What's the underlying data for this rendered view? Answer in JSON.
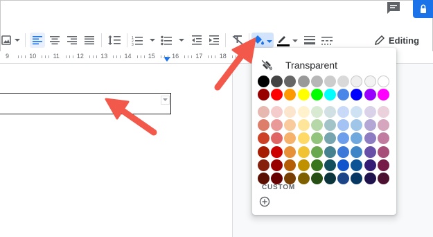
{
  "header": {
    "comment_icon": "comment-icon",
    "lock_icon": "lock-icon",
    "accent": "#1a73e8"
  },
  "toolbar": {
    "editing_label": "Editing",
    "icons": [
      "image-icon",
      "chevron-down-icon",
      "align-left-icon",
      "align-center-icon",
      "align-right-icon",
      "align-justify-icon",
      "line-spacing-icon",
      "numbered-list-icon",
      "bulleted-list-icon",
      "decrease-indent-icon",
      "increase-indent-icon",
      "clear-formatting-icon",
      "highlight-color-icon",
      "text-color-icon",
      "border-weight-icon",
      "border-dash-icon",
      "pencil-icon"
    ]
  },
  "ruler": {
    "numbers": [
      "9",
      "10",
      "11",
      "12",
      "13",
      "14",
      "15",
      "16",
      "17",
      "18"
    ]
  },
  "palette": {
    "transparent_label": "Transparent",
    "custom_label": "CUSTOM",
    "rows": [
      [
        "#000000",
        "#434343",
        "#666666",
        "#999999",
        "#b7b7b7",
        "#cccccc",
        "#d9d9d9",
        "#efefef",
        "#f3f3f3",
        "#ffffff"
      ],
      [
        "#980000",
        "#ff0000",
        "#ff9900",
        "#ffff00",
        "#00ff00",
        "#00ffff",
        "#4a86e8",
        "#0000ff",
        "#9900ff",
        "#ff00ff"
      ],
      [
        "#e6b8af",
        "#f4cccc",
        "#fce5cd",
        "#fff2cc",
        "#d9ead3",
        "#d0e0e3",
        "#c9daf8",
        "#cfe2f3",
        "#d9d2e9",
        "#ead1dc"
      ],
      [
        "#dd7e6b",
        "#ea9999",
        "#f9cb9c",
        "#ffe599",
        "#b6d7a8",
        "#a2c4c9",
        "#a4c2f4",
        "#9fc5e8",
        "#b4a7d6",
        "#d5a6bd"
      ],
      [
        "#cc4125",
        "#e06666",
        "#f6b26b",
        "#ffd966",
        "#93c47d",
        "#76a5af",
        "#6d9eeb",
        "#6fa8dc",
        "#8e7cc3",
        "#c27ba0"
      ],
      [
        "#a61c00",
        "#cc0000",
        "#e69138",
        "#f1c232",
        "#6aa84f",
        "#45818e",
        "#3c78d8",
        "#3d85c6",
        "#674ea7",
        "#a64d79"
      ],
      [
        "#85200c",
        "#990000",
        "#b45f06",
        "#bf9000",
        "#38761d",
        "#134f5c",
        "#1155cc",
        "#0b5394",
        "#351c75",
        "#741b47"
      ],
      [
        "#5b0f00",
        "#660000",
        "#783f04",
        "#7f6000",
        "#274e13",
        "#0c343d",
        "#1c4587",
        "#073763",
        "#20124d",
        "#4c1130"
      ]
    ]
  },
  "annotation": {
    "arrow_color": "#f2594b"
  }
}
